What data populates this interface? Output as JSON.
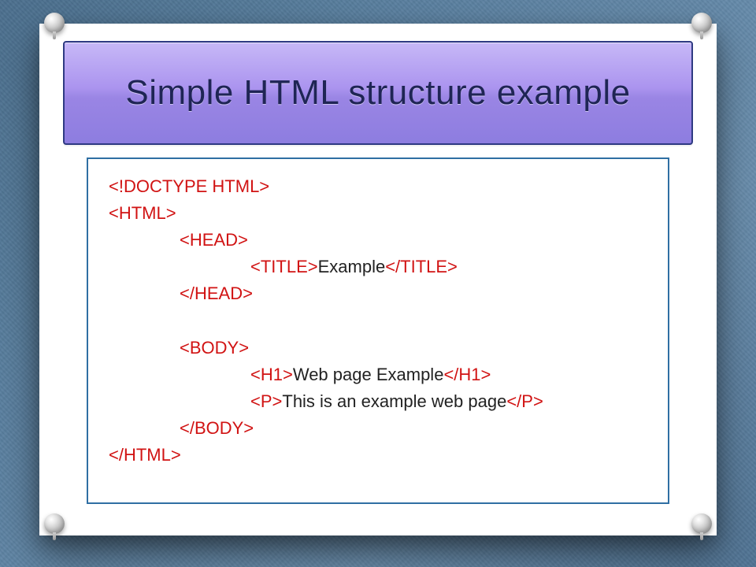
{
  "title": "Simple HTML structure example",
  "code": {
    "l1": "<!DOCTYPE HTML>",
    "l2": "<HTML>",
    "l3": "<HEAD>",
    "l4_open": "<TITLE>",
    "l4_text": "Example",
    "l4_close": "</TITLE>",
    "l5": "</HEAD>",
    "l6": "<BODY>",
    "l7_open": "<H1>",
    "l7_text": "Web page Example",
    "l7_close": "</H1>",
    "l8_open": "<P>",
    "l8_text": "This is an example web page",
    "l8_close": "</P>",
    "l9": "</BODY>",
    "l10": "</HTML>"
  }
}
